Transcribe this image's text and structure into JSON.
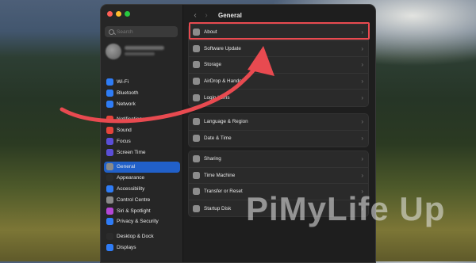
{
  "search": {
    "placeholder": "Search"
  },
  "sidebar": {
    "group1": [
      {
        "label": "Wi-Fi",
        "icon": "wifi-icon",
        "color": "#2f7cf6"
      },
      {
        "label": "Bluetooth",
        "icon": "bluetooth-icon",
        "color": "#2f7cf6"
      },
      {
        "label": "Network",
        "icon": "network-icon",
        "color": "#2f7cf6"
      }
    ],
    "group2": [
      {
        "label": "Notifications",
        "icon": "notifications-icon",
        "color": "#e5443b"
      },
      {
        "label": "Sound",
        "icon": "sound-icon",
        "color": "#e5443b"
      },
      {
        "label": "Focus",
        "icon": "focus-icon",
        "color": "#5b4ed8"
      },
      {
        "label": "Screen Time",
        "icon": "screen-time-icon",
        "color": "#5b4ed8"
      }
    ],
    "group3": [
      {
        "label": "General",
        "icon": "general-icon",
        "color": "#8a8a8a",
        "active": true
      },
      {
        "label": "Appearance",
        "icon": "appearance-icon",
        "color": "#2b2b2b"
      },
      {
        "label": "Accessibility",
        "icon": "accessibility-icon",
        "color": "#2f7cf6"
      },
      {
        "label": "Control Centre",
        "icon": "control-centre-icon",
        "color": "#8a8a8a"
      },
      {
        "label": "Siri & Spotlight",
        "icon": "siri-icon",
        "color": "#b347d6"
      },
      {
        "label": "Privacy & Security",
        "icon": "privacy-icon",
        "color": "#2f7cf6"
      }
    ],
    "group4": [
      {
        "label": "Desktop & Dock",
        "icon": "desktop-dock-icon",
        "color": "#2b2b2b"
      },
      {
        "label": "Displays",
        "icon": "displays-icon",
        "color": "#2f7cf6"
      }
    ]
  },
  "header": {
    "back": "‹",
    "forward": "›",
    "title": "General"
  },
  "main": {
    "group1": [
      {
        "label": "About",
        "icon": "about-icon"
      },
      {
        "label": "Software Update",
        "icon": "software-update-icon"
      },
      {
        "label": "Storage",
        "icon": "storage-icon"
      },
      {
        "label": "AirDrop & Handoff",
        "icon": "airdrop-icon"
      },
      {
        "label": "Login Items",
        "icon": "login-items-icon"
      }
    ],
    "group2": [
      {
        "label": "Language & Region",
        "icon": "language-icon"
      },
      {
        "label": "Date & Time",
        "icon": "date-time-icon"
      }
    ],
    "group3": [
      {
        "label": "Sharing",
        "icon": "sharing-icon"
      },
      {
        "label": "Time Machine",
        "icon": "time-machine-icon"
      },
      {
        "label": "Transfer or Reset",
        "icon": "transfer-reset-icon"
      },
      {
        "label": "Startup Disk",
        "icon": "startup-disk-icon"
      }
    ]
  },
  "watermark": "PiMyLife Up",
  "colors": {
    "highlight": "#e84a50",
    "active": "#2160c9"
  }
}
